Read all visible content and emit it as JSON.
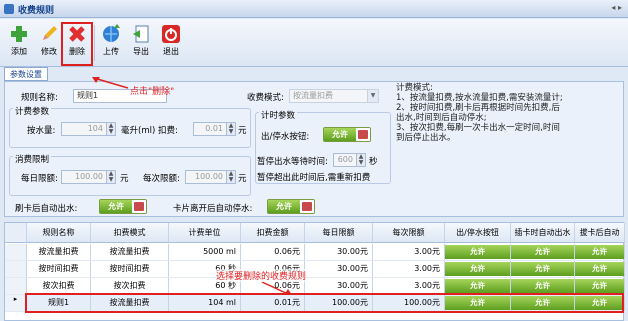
{
  "window": {
    "title": "收费规则"
  },
  "toolbar": {
    "add": "添加",
    "edit": "修改",
    "delete": "删除",
    "upload": "上传",
    "export": "导出",
    "exit": "退出"
  },
  "tabs": [
    "参数设置"
  ],
  "form": {
    "rule_name_label": "规则名称:",
    "rule_name_value": "规则1",
    "fee_mode_label": "收费模式:",
    "fee_mode_value": "按流量扣费",
    "fee_params_title": "计费参数",
    "water_label": "按水量:",
    "water_value": "104",
    "ml_label": "毫升(ml) 扣费:",
    "fee_value": "0.01",
    "yuan1": "元",
    "limit_title": "消费限制",
    "daily_label": "每日限额:",
    "daily_value": "100.00",
    "yuan2": "元",
    "each_label": "每次限额:",
    "each_value": "100.00",
    "yuan3": "元",
    "time_params_title": "计时参数",
    "outlet_label": "出/停水按钮:",
    "toggle_on": "允许",
    "pause_label": "暂停出水等待时间:",
    "pause_value": "600",
    "seconds": "秒",
    "pause_note": "暂停超出此时间后,需重新扣费",
    "auto_out_label": "刷卡后自动出水:",
    "auto_stop_label": "卡片离开后自动停水:"
  },
  "help": {
    "title": "计费模式:",
    "lines": [
      "1、按流量扣费,按水流量扣费,需安装流量计;",
      "2、按时间扣费,刷卡后再根据时间先扣费,后出水,时间到后自动停水;",
      "3、按次扣费,每刷一次卡出水一定时间,时间到后停止出水。"
    ]
  },
  "annotations": {
    "delete_hint": "点击\"删除\"",
    "select_hint": "选择要删除的收费规则"
  },
  "grid": {
    "headers": [
      "规则名称",
      "扣费模式",
      "计费单位",
      "扣费金额",
      "每日限额",
      "每次限额",
      "出/停水按钮",
      "插卡时自动出水",
      "拔卡后自动"
    ],
    "rows": [
      {
        "name": "按流量扣费",
        "mode": "按流量扣费",
        "unit": "5000 ml",
        "fee": "0.06元",
        "daily": "30.00元",
        "each": "3.00元",
        "b1": "允许",
        "b2": "允许",
        "b3": "允许"
      },
      {
        "name": "按时间扣费",
        "mode": "按时间扣费",
        "unit": "60 秒",
        "fee": "0.06元",
        "daily": "30.00元",
        "each": "3.00元",
        "b1": "允许",
        "b2": "允许",
        "b3": "允许"
      },
      {
        "name": "按次扣费",
        "mode": "按次扣费",
        "unit": "60 秒",
        "fee": "0.06元",
        "daily": "30.00元",
        "each": "3.00元",
        "b1": "允许",
        "b2": "允许",
        "b3": "允许"
      },
      {
        "name": "规则1",
        "mode": "按流量扣费",
        "unit": "104 ml",
        "fee": "0.01元",
        "daily": "100.00元",
        "each": "100.00元",
        "b1": "允许",
        "b2": "允许",
        "b3": "允许"
      }
    ]
  },
  "colors": {
    "accent": "#15428b",
    "annotation": "#e02020",
    "toggle": "#5d9e1f"
  }
}
